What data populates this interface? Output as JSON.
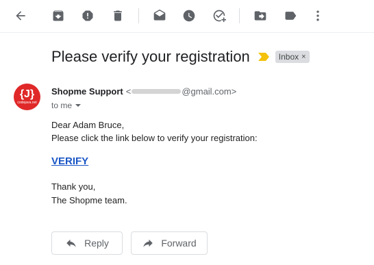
{
  "toolbar": {
    "icons": [
      "back-arrow-icon",
      "archive-icon",
      "report-spam-icon",
      "delete-icon",
      "mark-unread-icon",
      "snooze-icon",
      "add-to-tasks-icon",
      "move-to-icon",
      "labels-icon",
      "more-icon"
    ]
  },
  "email": {
    "subject": "Please verify your registration",
    "label": "Inbox",
    "label_close": "×",
    "avatar_letter": "{J}",
    "avatar_subtext": "codejava.net",
    "sender_name": "Shopme Support",
    "sender_email_prefix": "<",
    "sender_email_suffix": "@gmail.com>",
    "to": "to me",
    "greeting": "Dear Adam Bruce,",
    "instruction": "Please click the link below to verify your registration:",
    "link": "VERIFY",
    "closing_line1": "Thank you,",
    "closing_line2": "The Shopme team."
  },
  "actions": {
    "reply": "Reply",
    "forward": "Forward"
  },
  "colors": {
    "accent_link": "#1a56c6",
    "importance_marker": "#f4c20d",
    "avatar_bg": "#e02828"
  }
}
